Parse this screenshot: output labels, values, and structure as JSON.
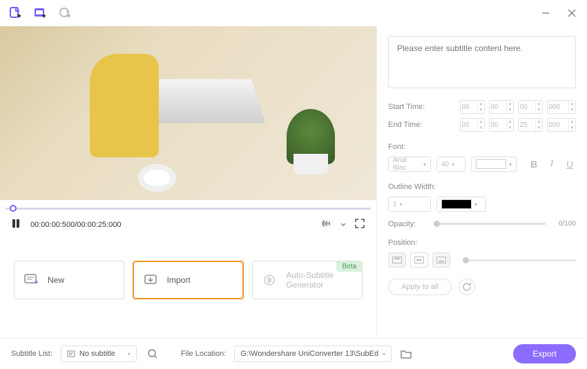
{
  "topbar": {
    "icons": [
      "add-file",
      "add-folder",
      "refresh"
    ]
  },
  "player": {
    "current_time": "00:00:00:500",
    "total_time": "00:00:25:000",
    "time_display": "00:00:00:500/00:00:25:000"
  },
  "actions": {
    "new_label": "New",
    "import_label": "Import",
    "auto_label": "Auto-Subtitle Generator",
    "beta_label": "Beta"
  },
  "subtitle": {
    "placeholder": "Please enter subtitle content here."
  },
  "times": {
    "start_label": "Start Time:",
    "end_label": "End Time:",
    "start": {
      "h": "00",
      "m": "00",
      "s": "00",
      "ms": "000"
    },
    "end": {
      "h": "00",
      "m": "00",
      "s": "25",
      "ms": "000"
    }
  },
  "font": {
    "label": "Font:",
    "family": "Arial Blac",
    "size": "40",
    "bold": "B",
    "italic": "I",
    "underline": "U"
  },
  "outline": {
    "label": "Outline Width:",
    "value": "1"
  },
  "opacity": {
    "label": "Opacity:",
    "value": "0/100"
  },
  "position": {
    "label": "Position:"
  },
  "apply": {
    "label": "Apply to all"
  },
  "bottom": {
    "subtitle_list_label": "Subtitle List:",
    "subtitle_list_value": "No subtitle",
    "file_location_label": "File Location:",
    "file_location_value": "G:\\Wondershare UniConverter 13\\SubEd",
    "export_label": "Export"
  }
}
